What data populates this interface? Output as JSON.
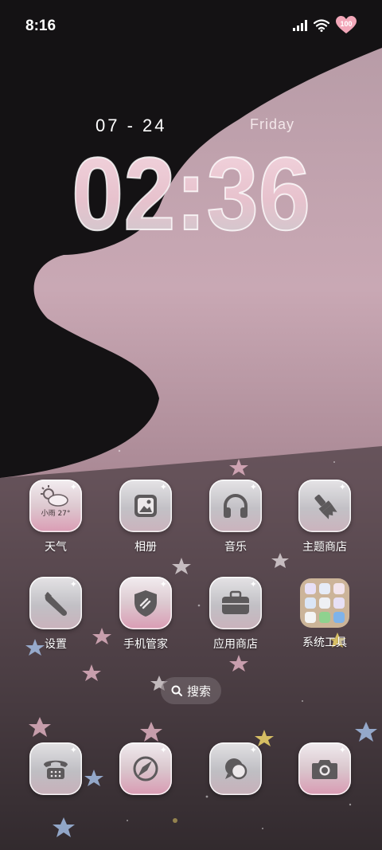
{
  "status_bar": {
    "time": "8:16",
    "battery_level": "100"
  },
  "lockscreen": {
    "date": "07 - 24",
    "weekday": "Friday",
    "clock": "02:36"
  },
  "apps": [
    {
      "label": "天气",
      "icon": "weather-icon",
      "temp_text": "小雨 27°"
    },
    {
      "label": "相册",
      "icon": "gallery-icon"
    },
    {
      "label": "音乐",
      "icon": "headphones-icon"
    },
    {
      "label": "主题商店",
      "icon": "paintbrush-icon"
    },
    {
      "label": "设置",
      "icon": "wrench-icon"
    },
    {
      "label": "手机管家",
      "icon": "shield-icon"
    },
    {
      "label": "应用商店",
      "icon": "briefcase-icon"
    },
    {
      "label": "系统工具",
      "icon": "folder-icon"
    }
  ],
  "search": {
    "label": "搜索",
    "icon": "search-icon"
  },
  "dock": [
    {
      "icon": "phone-icon"
    },
    {
      "icon": "compass-icon"
    },
    {
      "icon": "chat-bubble-icon"
    },
    {
      "icon": "camera-icon"
    }
  ]
}
